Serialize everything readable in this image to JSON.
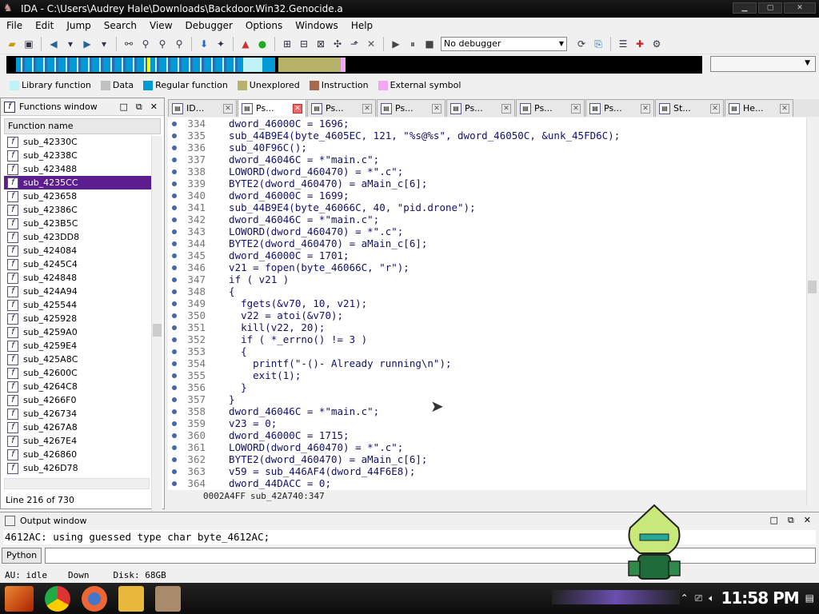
{
  "window": {
    "title": "IDA - C:\\Users\\Audrey Hale\\Downloads\\Backdoor.Win32.Genocide.a",
    "controls": [
      "▭",
      "▭",
      "▭"
    ]
  },
  "menu": [
    "File",
    "Edit",
    "Jump",
    "Search",
    "View",
    "Debugger",
    "Options",
    "Windows",
    "Help"
  ],
  "toolbar": {
    "debugger_select": "No debugger"
  },
  "legend": [
    {
      "label": "Library function",
      "color": "#bff3f7"
    },
    {
      "label": "Data",
      "color": "#c0c0c0"
    },
    {
      "label": "Regular function",
      "color": "#009ad6"
    },
    {
      "label": "Unexplored",
      "color": "#b5b36a"
    },
    {
      "label": "Instruction",
      "color": "#a66b4d"
    },
    {
      "label": "External symbol",
      "color": "#f4a6f0"
    }
  ],
  "functions_window": {
    "title": "Functions window",
    "column": "Function name",
    "items": [
      "sub_42330C",
      "sub_42338C",
      "sub_423488",
      "sub_4235CC",
      "sub_423658",
      "sub_42386C",
      "sub_423B5C",
      "sub_423DD8",
      "sub_424084",
      "sub_4245C4",
      "sub_424848",
      "sub_424A94",
      "sub_425544",
      "sub_425928",
      "sub_4259A0",
      "sub_4259E4",
      "sub_425A8C",
      "sub_42600C",
      "sub_4264C8",
      "sub_4266F0",
      "sub_426734",
      "sub_4267A8",
      "sub_4267E4",
      "sub_426860",
      "sub_426D78"
    ],
    "selected_index": 3,
    "line_info": "Line 216 of 730"
  },
  "tabs": [
    "ID...",
    "Ps...",
    "Ps...",
    "Ps...",
    "Ps...",
    "Ps...",
    "Ps...",
    "St...",
    "He..."
  ],
  "active_tab": 1,
  "code_lines": [
    {
      "n": "334",
      "t": "  dword_46000C = 1696;"
    },
    {
      "n": "335",
      "t": "  sub_44B9E4(byte_4605EC, 121, \"%s@%s\", dword_46050C, &unk_45FD6C);"
    },
    {
      "n": "336",
      "t": "  sub_40F96C();"
    },
    {
      "n": "337",
      "t": "  dword_46046C = *\"main.c\";"
    },
    {
      "n": "338",
      "t": "  LOWORD(dword_460470) = *\".c\";"
    },
    {
      "n": "339",
      "t": "  BYTE2(dword_460470) = aMain_c[6];"
    },
    {
      "n": "340",
      "t": "  dword_46000C = 1699;"
    },
    {
      "n": "341",
      "t": "  sub_44B9E4(byte_46066C, 40, \"pid.drone\");"
    },
    {
      "n": "342",
      "t": "  dword_46046C = *\"main.c\";"
    },
    {
      "n": "343",
      "t": "  LOWORD(dword_460470) = *\".c\";"
    },
    {
      "n": "344",
      "t": "  BYTE2(dword_460470) = aMain_c[6];"
    },
    {
      "n": "345",
      "t": "  dword_46000C = 1701;"
    },
    {
      "n": "346",
      "t": "  v21 = fopen(byte_46066C, \"r\");"
    },
    {
      "n": "347",
      "t": "  if ( v21 )"
    },
    {
      "n": "348",
      "t": "  {"
    },
    {
      "n": "349",
      "t": "    fgets(&v70, 10, v21);"
    },
    {
      "n": "350",
      "t": "    v22 = atoi(&v70);"
    },
    {
      "n": "351",
      "t": "    kill(v22, 20);"
    },
    {
      "n": "352",
      "t": "    if ( *_errno() != 3 )"
    },
    {
      "n": "353",
      "t": "    {"
    },
    {
      "n": "354",
      "t": "      printf(\"-()- Already running\\n\");"
    },
    {
      "n": "355",
      "t": "      exit(1);"
    },
    {
      "n": "356",
      "t": "    }"
    },
    {
      "n": "357",
      "t": "  }"
    },
    {
      "n": "358",
      "t": "  dword_46046C = *\"main.c\";"
    },
    {
      "n": "359",
      "t": "  v23 = 0;"
    },
    {
      "n": "360",
      "t": "  dword_46000C = 1715;"
    },
    {
      "n": "361",
      "t": "  LOWORD(dword_460470) = *\".c\";"
    },
    {
      "n": "362",
      "t": "  BYTE2(dword_460470) = aMain_c[6];"
    },
    {
      "n": "363",
      "t": "  v59 = sub_446AF4(dword_44F6E8);"
    },
    {
      "n": "364",
      "t": "  dword_44DACC = 0;"
    }
  ],
  "code_status": {
    "address": "0002A4FF",
    "location": "sub_42A740:347"
  },
  "output_window": {
    "title": "Output window",
    "text": "4612AC: using guessed type char byte_4612AC;",
    "python_button": "Python"
  },
  "ida_status": {
    "state": "AU:  idle",
    "direction": "Down",
    "disk": "Disk: 68GB"
  },
  "taskbar": {
    "clock": "11:58 PM"
  }
}
